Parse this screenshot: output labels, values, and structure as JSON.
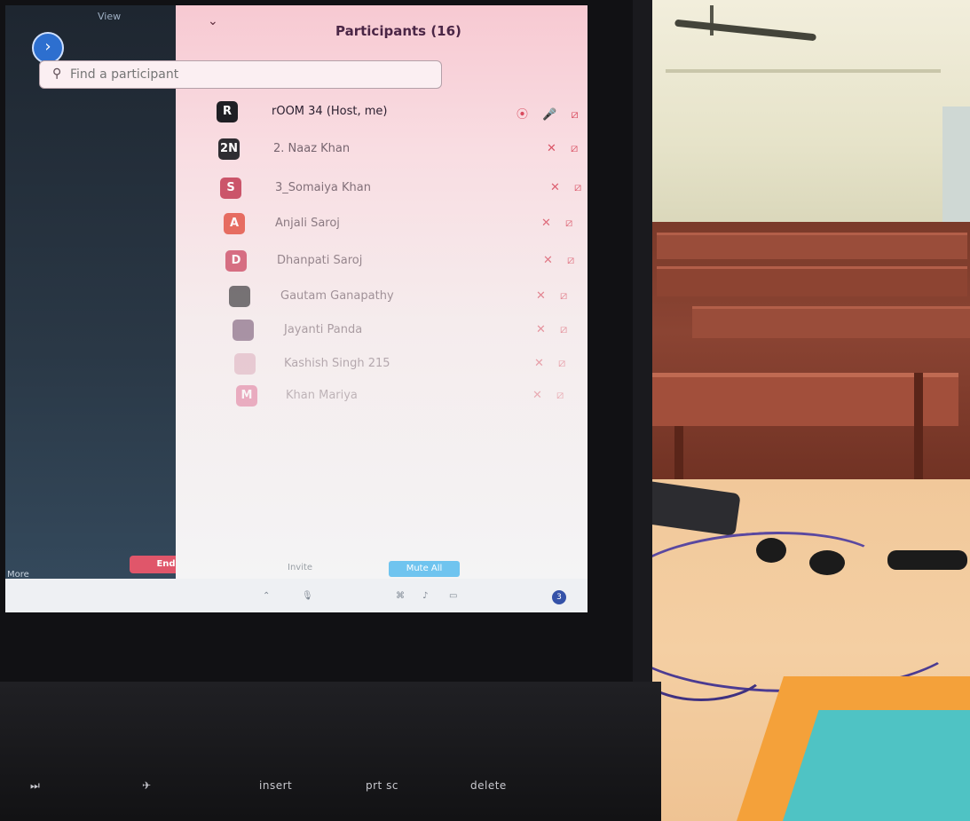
{
  "panel": {
    "title": "Participants (16)",
    "collapse_icon": "chevron-down-icon"
  },
  "search": {
    "icon": "search-icon",
    "placeholder": "Find a participant"
  },
  "participants": [
    {
      "initials": "R",
      "name": "rOOM 34 (Host, me)",
      "color": "#1f1f24",
      "icons": "⦿ 🎤 ⧄"
    },
    {
      "initials": "2N",
      "name": "2. Naaz Khan",
      "color": "#1f1f24",
      "icons": "✕ ⧄"
    },
    {
      "initials": "S",
      "name": "3_Somaiya Khan",
      "color": "#c43d55",
      "icons": "✕ ⧄"
    },
    {
      "initials": "A",
      "name": "Anjali Saroj",
      "color": "#e24b3b",
      "icons": "✕ ⧄"
    },
    {
      "initials": "D",
      "name": "Dhanpati Saroj",
      "color": "#c93b57",
      "icons": "✕ ⧄"
    },
    {
      "initials": "",
      "name": "Gautam Ganapathy",
      "color": "#2a2a2e",
      "icons": "✕ ⧄"
    },
    {
      "initials": "",
      "name": "Jayanti Panda",
      "color": "#6a4a6a",
      "icons": "✕ ⧄"
    },
    {
      "initials": "",
      "name": "Kashish Singh 215",
      "color": "#d9a3b5",
      "icons": "✕ ⧄"
    },
    {
      "initials": "M",
      "name": "Khan Mariya",
      "color": "#d9497a",
      "icons": "✕ ⧄"
    }
  ],
  "video": {
    "view_label": "View",
    "more_label": "More",
    "end_label": "End",
    "expand_icon": "chevron-right-icon"
  },
  "footer": {
    "mute_all_label": "Mute All"
  },
  "keyboard": {
    "insert": "insert",
    "prtsc": "prt sc",
    "delete": "delete"
  },
  "colors": {
    "end_button": "#e0566a",
    "mute_all": "#6fc4ef",
    "muted_icon": "#d84a5d"
  }
}
